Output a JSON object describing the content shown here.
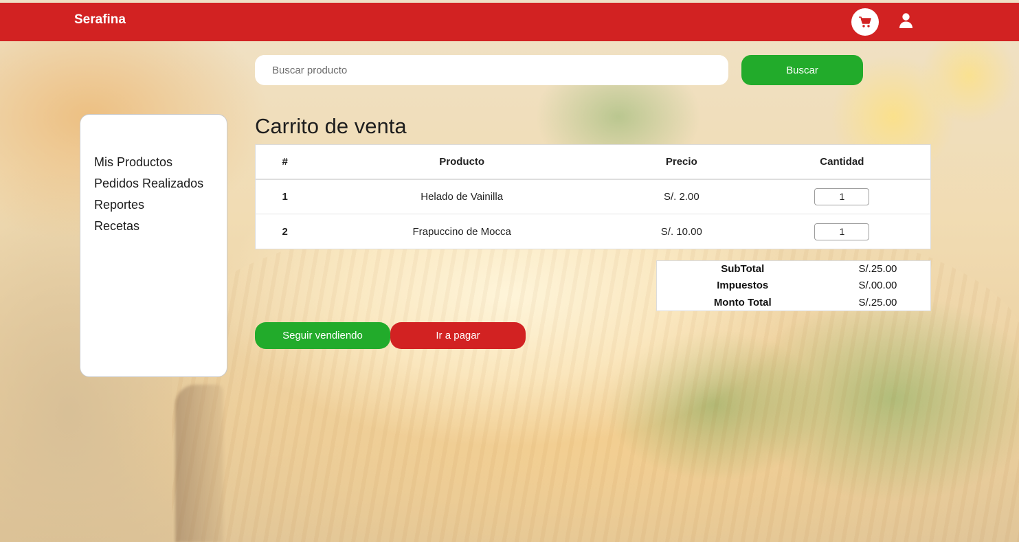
{
  "brand": "Serafina",
  "colors": {
    "primary_red": "#d22222",
    "accent_green": "#22ab2b",
    "panel_white": "#ffffff"
  },
  "header": {
    "cart_icon": "shopping-cart-icon",
    "user_icon": "user-icon"
  },
  "search": {
    "placeholder": "Buscar producto",
    "value": "",
    "button_label": "Buscar"
  },
  "sidebar": {
    "items": [
      {
        "label": "Mis Productos"
      },
      {
        "label": "Pedidos Realizados"
      },
      {
        "label": "Reportes"
      },
      {
        "label": "Recetas"
      }
    ]
  },
  "main": {
    "title": "Carrito de venta",
    "table": {
      "headers": [
        "#",
        "Producto",
        "Precio",
        "Cantidad"
      ],
      "rows": [
        {
          "index": "1",
          "product": "Helado de Vainilla",
          "price": "S/. 2.00",
          "quantity": "1"
        },
        {
          "index": "2",
          "product": "Frapuccino de Mocca",
          "price": "S/. 10.00",
          "quantity": "1"
        }
      ]
    },
    "totals": [
      {
        "label": "SubTotal",
        "value": "S/.25.00"
      },
      {
        "label": "Impuestos",
        "value": "S/.00.00"
      },
      {
        "label": "Monto Total",
        "value": "S/.25.00"
      }
    ],
    "actions": {
      "continue_label": "Seguir vendiendo",
      "pay_label": "Ir a pagar"
    }
  }
}
